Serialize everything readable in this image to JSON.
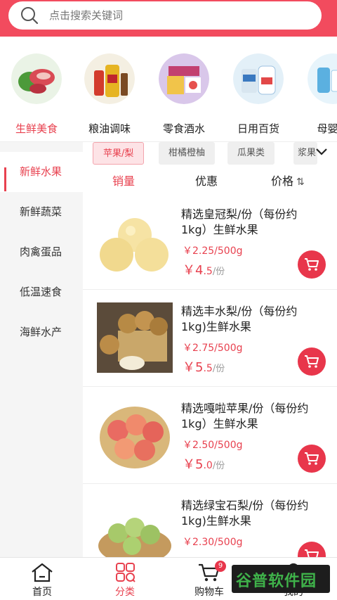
{
  "search": {
    "placeholder": "点击搜索关键词"
  },
  "categories": [
    {
      "label": "生鲜美食",
      "icon": "fresh-food-image"
    },
    {
      "label": "粮油调味",
      "icon": "grain-oil-image"
    },
    {
      "label": "零食酒水",
      "icon": "snacks-drinks-image"
    },
    {
      "label": "日用百货",
      "icon": "daily-goods-image"
    },
    {
      "label": "母婴玩",
      "icon": "mother-baby-image"
    }
  ],
  "sidebar": {
    "items": [
      {
        "label": "新鲜水果"
      },
      {
        "label": "新鲜蔬菜"
      },
      {
        "label": "肉禽蛋品"
      },
      {
        "label": "低温速食"
      },
      {
        "label": "海鲜水产"
      }
    ]
  },
  "chips": [
    {
      "label": "苹果/梨"
    },
    {
      "label": "柑橘橙柚"
    },
    {
      "label": "瓜果类"
    },
    {
      "label": "浆果"
    }
  ],
  "sorts": {
    "sales": "销量",
    "discount": "优惠",
    "price": "价格",
    "price_icon": "⇅"
  },
  "products": [
    {
      "name": "精选皇冠梨/份（每份约1kg）生鲜水果",
      "unit_price": "￥2.25/500g",
      "price_symbol": "￥",
      "price_int": "4",
      "price_dec": ".5",
      "per": "/份",
      "image": "crown-pear-image"
    },
    {
      "name": "精选丰水梨/份（每份约1kg)生鲜水果",
      "unit_price": "￥2.75/500g",
      "price_symbol": "￥",
      "price_int": "5",
      "price_dec": ".5",
      "per": "/份",
      "image": "fengshui-pear-image"
    },
    {
      "name": "精选嘎啦苹果/份（每份约1kg）生鲜水果",
      "unit_price": "￥2.50/500g",
      "price_symbol": "￥",
      "price_int": "5",
      "price_dec": ".0",
      "per": "/份",
      "image": "gala-apple-image"
    },
    {
      "name": "精选绿宝石梨/份（每份约1kg)生鲜水果",
      "unit_price": "￥2.30/500g",
      "price_symbol": "",
      "price_int": "",
      "price_dec": "",
      "per": "",
      "image": "green-pear-image"
    }
  ],
  "tabbar": {
    "home": "首页",
    "category": "分类",
    "cart": "购物车",
    "cart_badge": "9",
    "mine": "我的"
  },
  "watermark": {
    "text": "谷普软件园"
  }
}
